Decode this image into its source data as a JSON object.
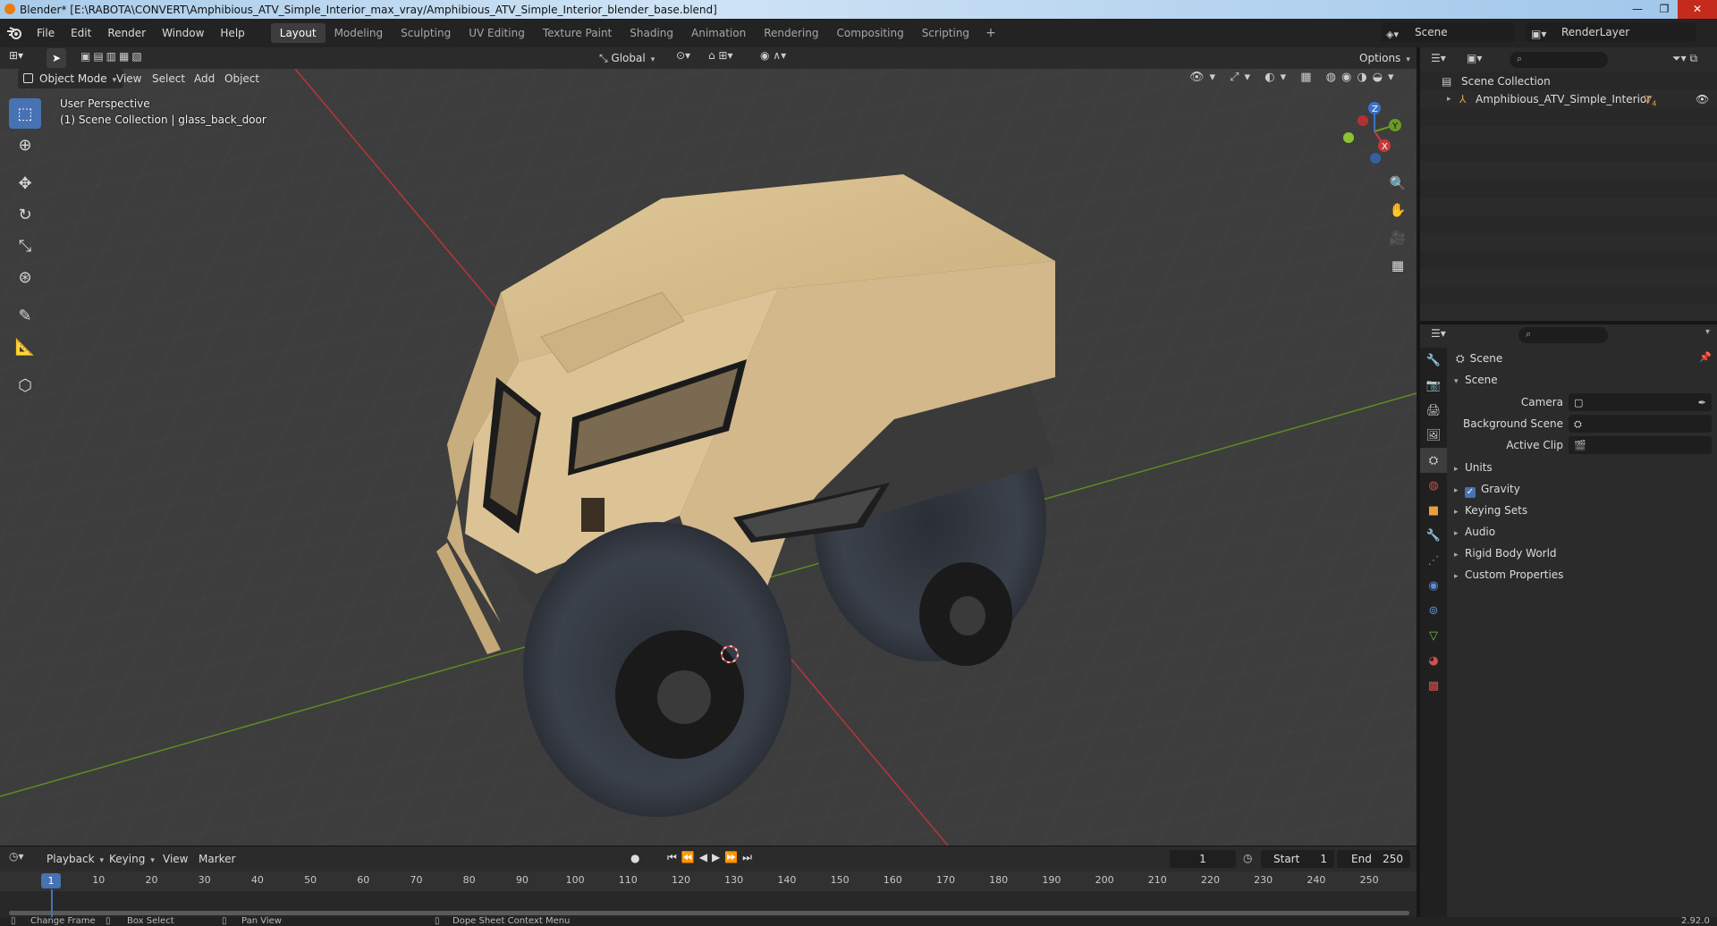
{
  "window": {
    "title": "Blender* [E:\\RABOTA\\CONVERT\\Amphibious_ATV_Simple_Interior_max_vray/Amphibious_ATV_Simple_Interior_blender_base.blend]",
    "minimize": "—",
    "maximize": "❐",
    "close": "✕"
  },
  "menu": {
    "file": "File",
    "edit": "Edit",
    "render": "Render",
    "window": "Window",
    "help": "Help"
  },
  "workspaces": [
    "Layout",
    "Modeling",
    "Sculpting",
    "UV Editing",
    "Texture Paint",
    "Shading",
    "Animation",
    "Rendering",
    "Compositing",
    "Scripting"
  ],
  "workspace_add": "+",
  "scene_selector": "Scene",
  "renderlayer_selector": "RenderLayer",
  "viewport": {
    "mode": "Object Mode",
    "menus": {
      "view": "View",
      "select": "Select",
      "add": "Add",
      "object": "Object"
    },
    "transform_orientation": "Global",
    "options": "Options",
    "perspective_label": "User Perspective",
    "collection_label": "(1) Scene Collection | glass_back_door",
    "gizmo": {
      "x": "X",
      "y": "Y",
      "z": "Z"
    }
  },
  "timeline": {
    "menus": {
      "playback": "Playback",
      "keying": "Keying",
      "view": "View",
      "marker": "Marker"
    },
    "current_frame": "1",
    "start_label": "Start",
    "start_value": "1",
    "end_label": "End",
    "end_value": "250",
    "ruler_ticks": [
      "10",
      "20",
      "30",
      "40",
      "50",
      "60",
      "70",
      "80",
      "90",
      "100",
      "110",
      "120",
      "130",
      "140",
      "150",
      "160",
      "170",
      "180",
      "190",
      "200",
      "210",
      "220",
      "230",
      "240",
      "250"
    ],
    "cursor_label": "1"
  },
  "statusbar": {
    "change_frame": "Change Frame",
    "box_select": "Box Select",
    "pan_view": "Pan View",
    "context_menu": "Dope Sheet Context Menu",
    "version": "2.92.0"
  },
  "outliner": {
    "root": "Scene Collection",
    "items": [
      {
        "name": "Amphibious_ATV_Simple_Interior",
        "badge": "4"
      }
    ]
  },
  "properties": {
    "context_title": "Scene",
    "panel_title": "Scene",
    "camera_label": "Camera",
    "background_scene_label": "Background Scene",
    "active_clip_label": "Active Clip",
    "subpanels": {
      "units": "Units",
      "gravity": "Gravity",
      "keying_sets": "Keying Sets",
      "audio": "Audio",
      "rigid_body_world": "Rigid Body World",
      "custom_properties": "Custom Properties"
    },
    "gravity_checked": true
  },
  "colors": {
    "accent": "#4772b3",
    "axis_x": "#c8383b",
    "axis_y": "#6a9a26",
    "body": "#d7be8f"
  }
}
